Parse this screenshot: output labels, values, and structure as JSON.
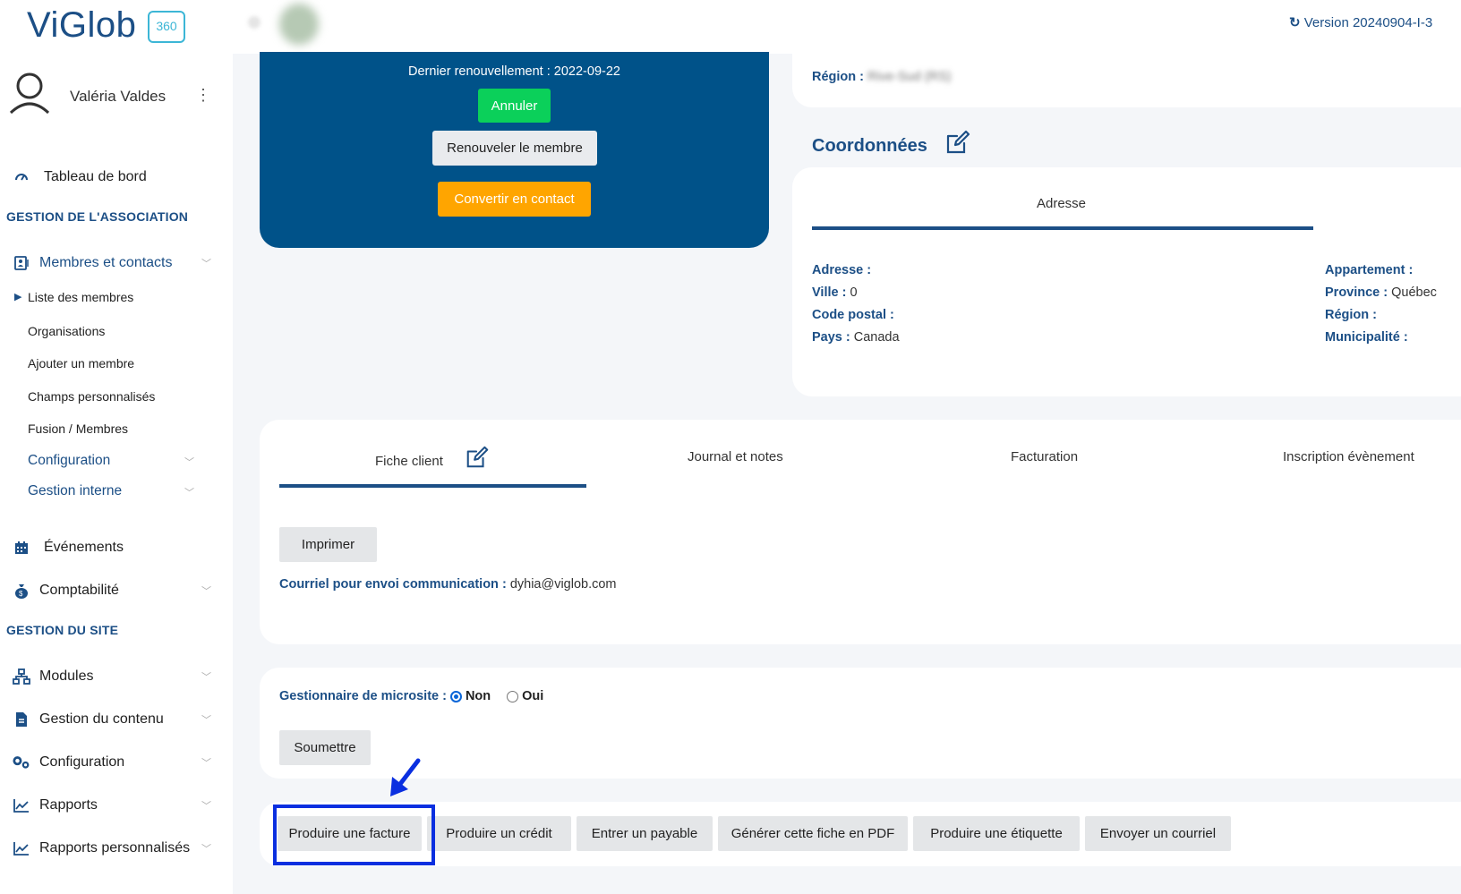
{
  "brand": {
    "name": "ViGlob",
    "badge": "360"
  },
  "user": {
    "name": "Valéria Valdes"
  },
  "version": "Version 20240904-I-3",
  "sidebar": {
    "dashboard": "Tableau de bord",
    "section_association": "GESTION DE L'ASSOCIATION",
    "members_contacts": "Membres et contacts",
    "sub_items": [
      "Liste des membres",
      "Organisations",
      "Ajouter un membre",
      "Champs personnalisés",
      "Fusion / Membres"
    ],
    "config_sub": "Configuration",
    "internal_mgmt": "Gestion interne",
    "events": "Événements",
    "accounting": "Comptabilité",
    "section_site": "GESTION DU SITE",
    "modules": "Modules",
    "content_mgmt": "Gestion du contenu",
    "configuration": "Configuration",
    "reports": "Rapports",
    "custom_reports": "Rapports personnalisés"
  },
  "membership": {
    "last_renewal": "Dernier renouvellement : 2022-09-22",
    "cancel": "Annuler",
    "renew": "Renouveler le membre",
    "convert": "Convertir en contact"
  },
  "region_top": {
    "label": "Région :",
    "value": "Rive-Sud (RS)"
  },
  "coordinates": {
    "title": "Coordonnées",
    "tab": "Adresse",
    "fields_left": [
      {
        "label": "Adresse :",
        "value": ""
      },
      {
        "label": "Ville :",
        "value": "0"
      },
      {
        "label": "Code postal :",
        "value": ""
      },
      {
        "label": "Pays :",
        "value": "Canada"
      }
    ],
    "fields_right": [
      {
        "label": "Appartement :",
        "value": ""
      },
      {
        "label": "Province :",
        "value": "Québec"
      },
      {
        "label": "Région :",
        "value": ""
      },
      {
        "label": "Municipalité :",
        "value": ""
      }
    ]
  },
  "tabs": [
    "Fiche client",
    "Journal et notes",
    "Facturation",
    "Inscription évènement"
  ],
  "fiche": {
    "print": "Imprimer",
    "email_label": "Courriel pour envoi communication :",
    "email_value": "dyhia@viglob.com"
  },
  "microsite": {
    "label": "Gestionnaire de microsite :",
    "option_no": "Non",
    "option_yes": "Oui",
    "submit": "Soumettre"
  },
  "actions": [
    "Produire une facture",
    "Produire un crédit",
    "Entrer un payable",
    "Générer cette fiche en PDF",
    "Produire une étiquette",
    "Envoyer un courriel"
  ],
  "colors": {
    "primary": "#1c4f86",
    "card_blue": "#005289",
    "green": "#0bd05a",
    "orange": "#ffa500",
    "highlight": "#0a2fe0"
  }
}
